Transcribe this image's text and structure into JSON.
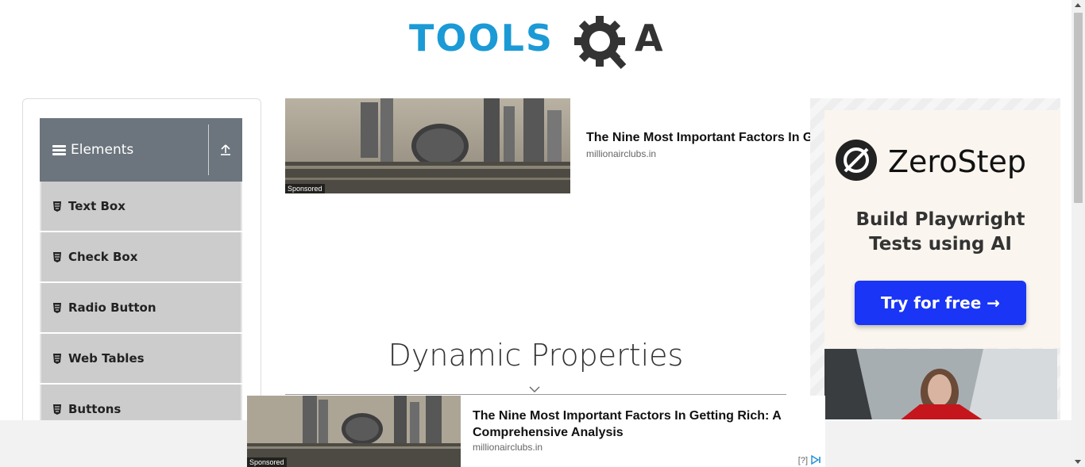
{
  "header": {
    "logo_part1": "TOOLS",
    "logo_part2": "A"
  },
  "sidebar": {
    "group_title": "Elements",
    "items": [
      {
        "label": "Text Box"
      },
      {
        "label": "Check Box"
      },
      {
        "label": "Radio Button"
      },
      {
        "label": "Web Tables"
      },
      {
        "label": "Buttons"
      }
    ]
  },
  "ad_top": {
    "sponsored": "Sponsored",
    "headline": "The Nine Most Important Factors In Getting Rich: A Comprehensive Analysis",
    "source": "millionairclubs.in"
  },
  "main": {
    "title": "Dynamic Properties"
  },
  "right_ad": {
    "brand": "ZeroStep",
    "tagline": "Build Playwright Tests using AI",
    "cta": "Try for free →"
  },
  "bottom_ad": {
    "sponsored": "Sponsored",
    "headline": "The Nine Most Important Factors In Getting Rich: A Comprehensive Analysis",
    "source": "millionairclubs.in",
    "info": "[?]"
  },
  "colors": {
    "logo_blue": "#1b9ad6",
    "logo_dark": "#333333",
    "sidebar_header": "#6c757d",
    "menu_item_bg": "#cccccc",
    "cta_blue": "#1a35f5"
  }
}
